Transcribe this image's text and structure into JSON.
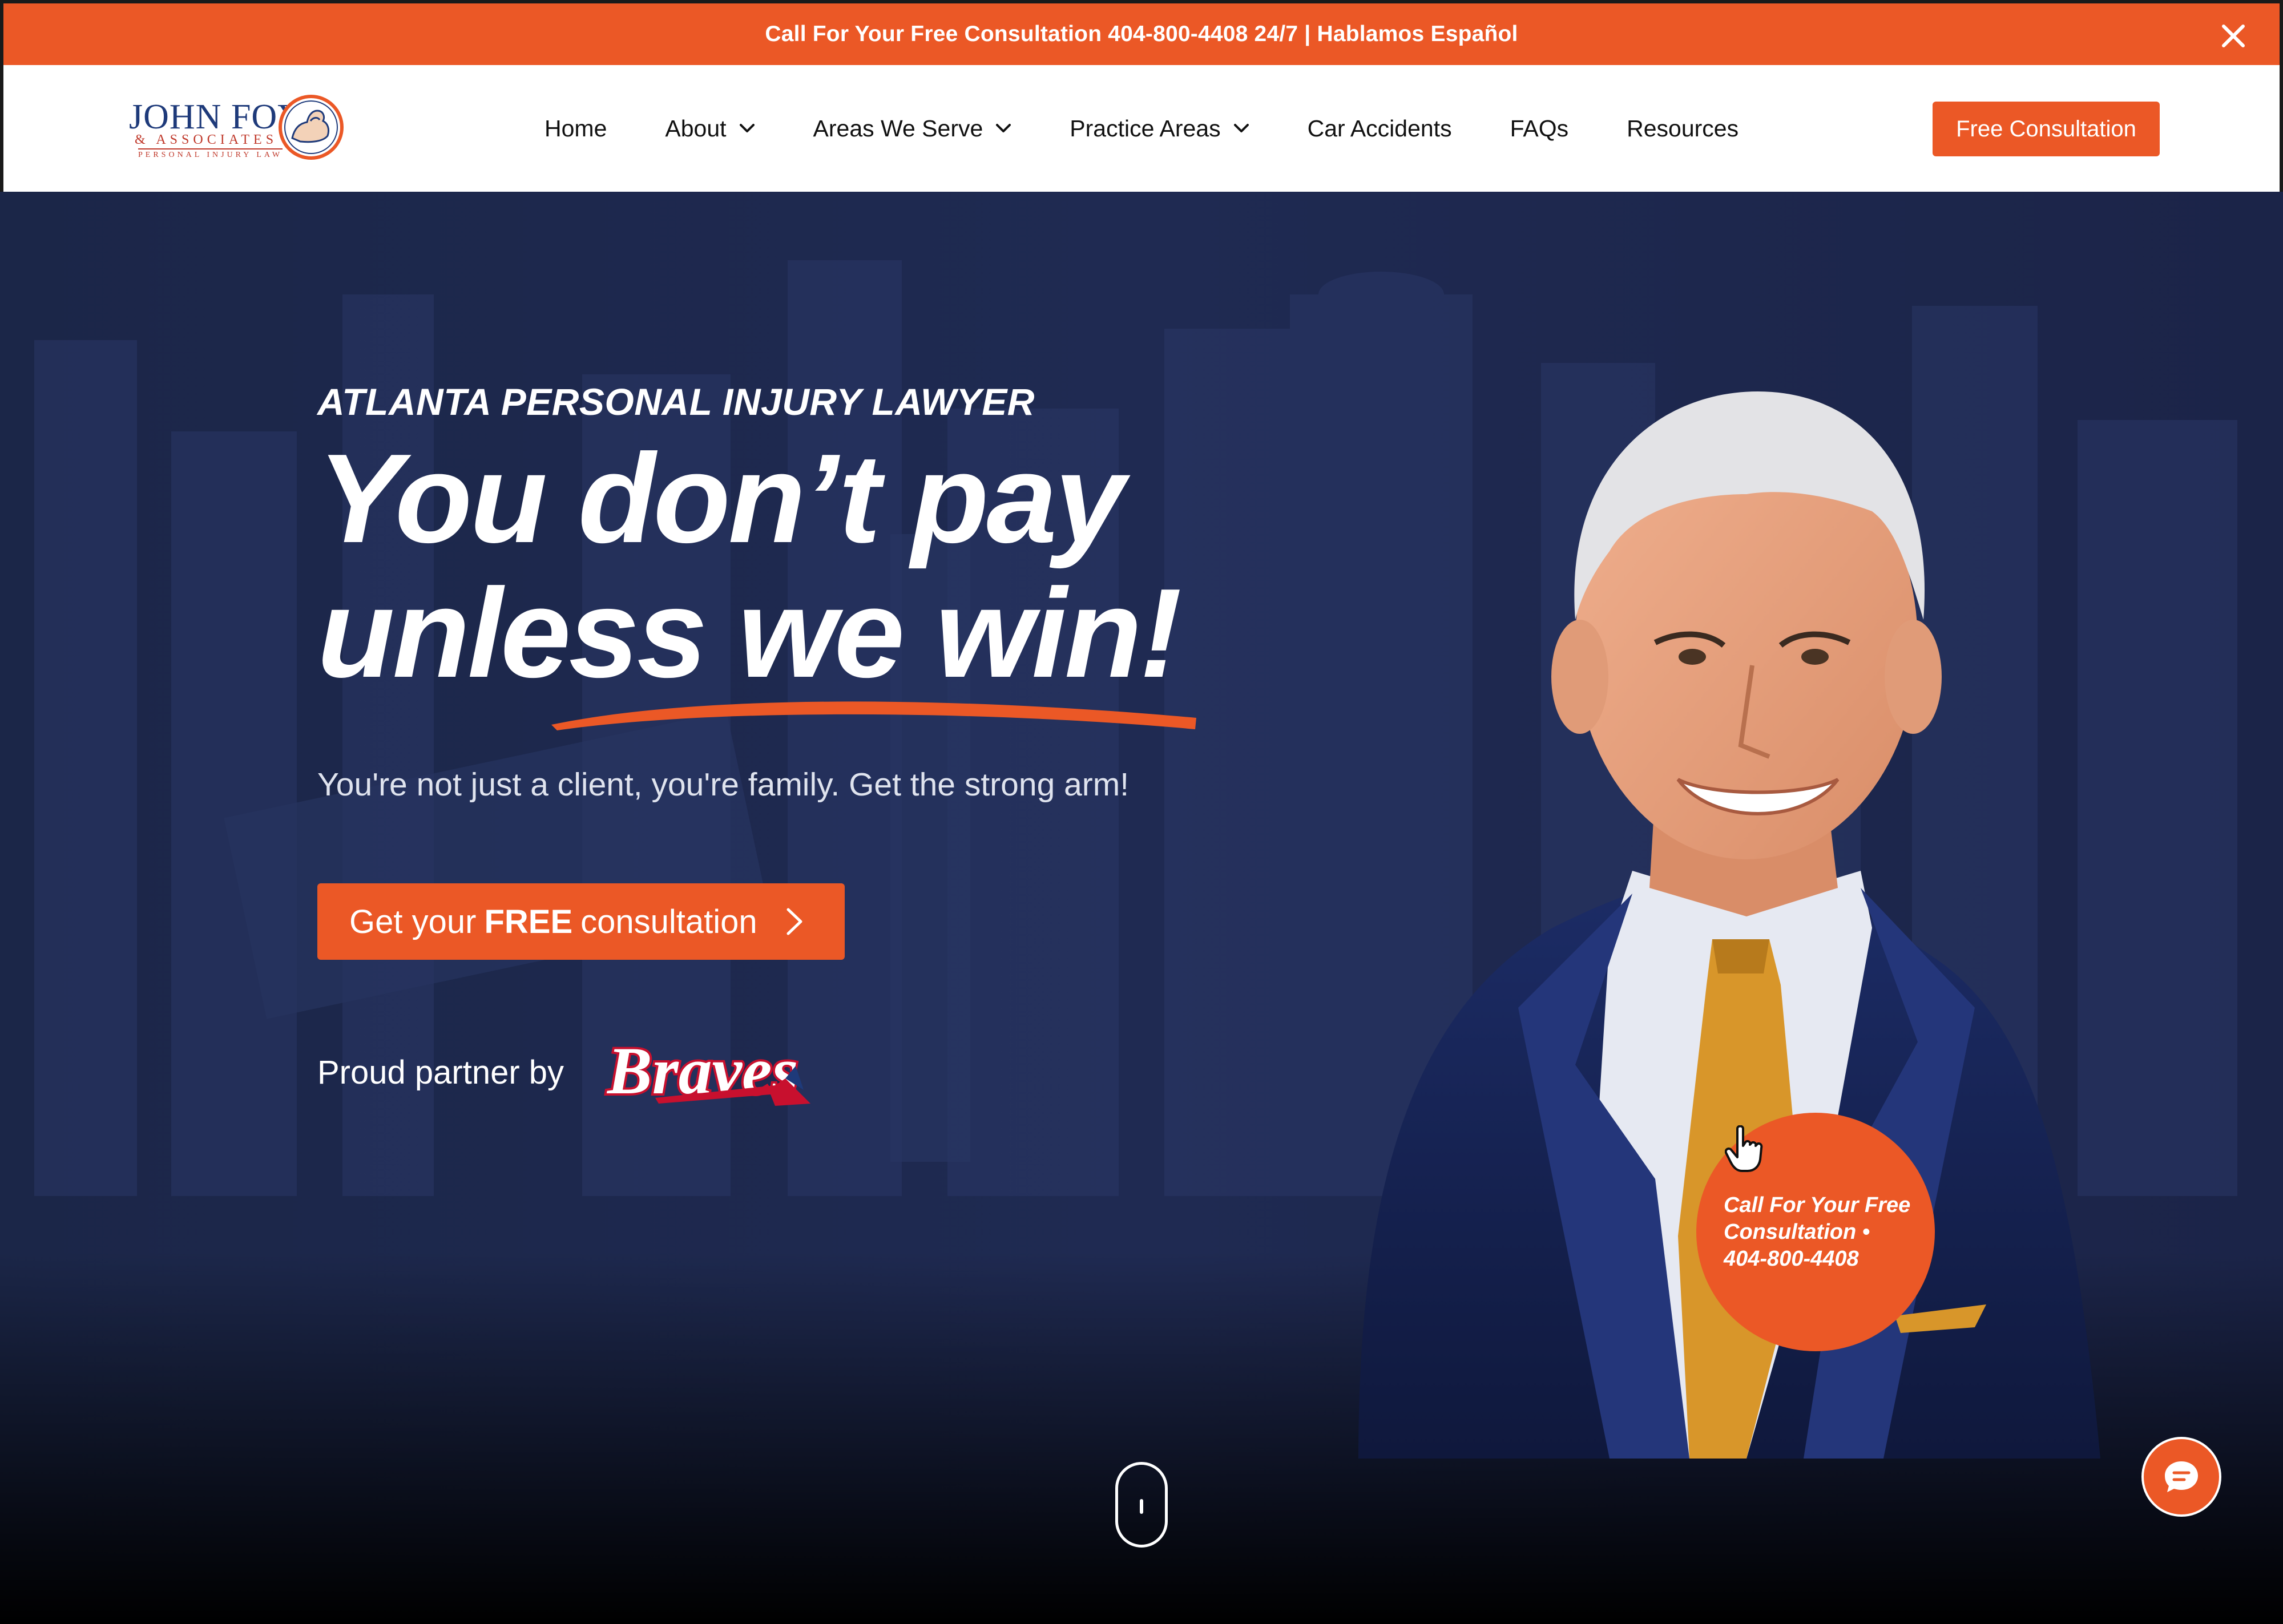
{
  "topbar": {
    "text": "Call For Your Free Consultation 404-800-4408 24/7 | Hablamos Español",
    "close_icon": "close-icon"
  },
  "nav": {
    "logo": {
      "name": "JOHN FOY",
      "associates": "& ASSOCIATES",
      "tagline": "PERSONAL INJURY LAW"
    },
    "items": [
      {
        "label": "Home",
        "has_dropdown": false
      },
      {
        "label": "About",
        "has_dropdown": true
      },
      {
        "label": "Areas We Serve",
        "has_dropdown": true
      },
      {
        "label": "Practice Areas",
        "has_dropdown": true
      },
      {
        "label": "Car Accidents",
        "has_dropdown": false
      },
      {
        "label": "FAQs",
        "has_dropdown": false
      },
      {
        "label": "Resources",
        "has_dropdown": false
      }
    ],
    "cta_label": "Free Consultation"
  },
  "hero": {
    "eyebrow": "ATLANTA PERSONAL INJURY LAWYER",
    "headline_line1": "You don’t pay",
    "headline_line2": "unless we win!",
    "subtitle": "You're not just a client, you're family. Get the strong arm!",
    "cta": {
      "prefix": "Get your",
      "bold": "FREE",
      "suffix": "consultation"
    },
    "partner_label": "Proud partner by",
    "partner_logo_text": "Braves",
    "call_bubble": {
      "line1": "Call For Your Free",
      "line2": "Consultation  •",
      "line3": "404-800-4408"
    }
  },
  "colors": {
    "accent": "#eb5826",
    "hero_bg": "#1f2a52",
    "logo_blue": "#1e3a7a",
    "braves_red": "#c8102e"
  },
  "icons": [
    "close-icon",
    "chevron-down-icon",
    "chevron-right-icon",
    "hand-cursor-icon",
    "chat-icon",
    "scroll-mouse-icon"
  ]
}
